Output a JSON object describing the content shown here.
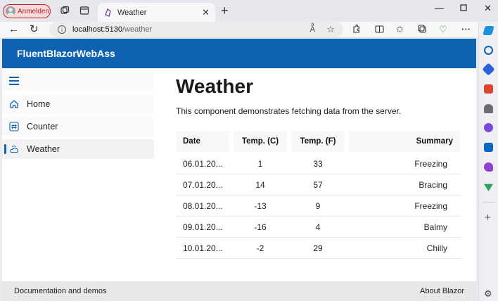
{
  "browser": {
    "profile_label": "Anmelden",
    "tab_title": "Weather",
    "url_host": "localhost:5130",
    "url_path": "/weather"
  },
  "app": {
    "brand": "FluentBlazorWebAss",
    "accent": "#0f62b1",
    "nav": [
      {
        "label": "Home",
        "icon": "home-icon"
      },
      {
        "label": "Counter",
        "icon": "number-symbol-icon"
      },
      {
        "label": "Weather",
        "icon": "weather-icon"
      }
    ],
    "active_nav": "Weather"
  },
  "page": {
    "title": "Weather",
    "description": "This component demonstrates fetching data from the server."
  },
  "table": {
    "headers": [
      "Date",
      "Temp. (C)",
      "Temp. (F)",
      "Summary"
    ],
    "rows": [
      [
        "06.01.20...",
        "1",
        "33",
        "Freezing"
      ],
      [
        "07.01.20...",
        "14",
        "57",
        "Bracing"
      ],
      [
        "08.01.20...",
        "-13",
        "9",
        "Freezing"
      ],
      [
        "09.01.20...",
        "-16",
        "4",
        "Balmy"
      ],
      [
        "10.01.20...",
        "-2",
        "29",
        "Chilly"
      ]
    ]
  },
  "footer": {
    "left": "Documentation and demos",
    "right": "About Blazor"
  }
}
